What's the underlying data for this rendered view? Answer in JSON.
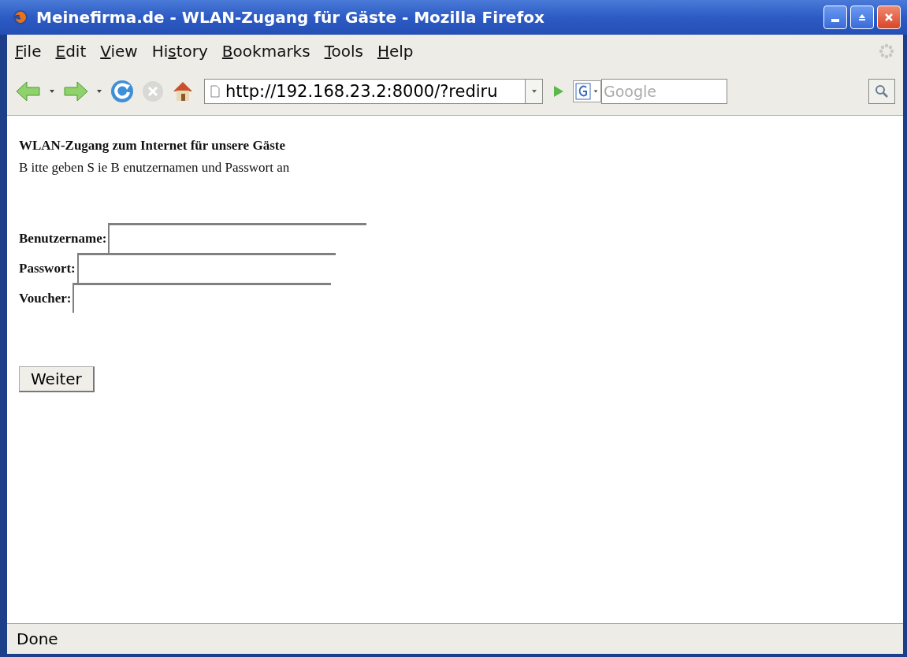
{
  "window": {
    "title": "Meinefirma.de - WLAN-Zugang für Gäste - Mozilla Firefox"
  },
  "menu": [
    {
      "mnemonic": "F",
      "after": "ile"
    },
    {
      "mnemonic": "E",
      "after": "dit"
    },
    {
      "mnemonic": "V",
      "after": "iew"
    },
    {
      "before": "Hi",
      "mnemonic": "s",
      "after": "tory"
    },
    {
      "mnemonic": "B",
      "after": "ookmarks"
    },
    {
      "mnemonic": "T",
      "after": "ools"
    },
    {
      "mnemonic": "H",
      "after": "elp"
    }
  ],
  "toolbar": {
    "url": "http://192.168.23.2:8000/?rediru",
    "search": {
      "placeholder": "Google"
    }
  },
  "page": {
    "heading": "WLAN-Zugang zum Internet für unsere Gäste",
    "intro": "B itte geben S ie B enutzernamen und Passwort an",
    "fields": [
      {
        "label": "Benutzername:"
      },
      {
        "label": "Passwort:"
      },
      {
        "label": "Voucher:"
      }
    ],
    "button": "Weiter"
  },
  "status_bar": "Done"
}
